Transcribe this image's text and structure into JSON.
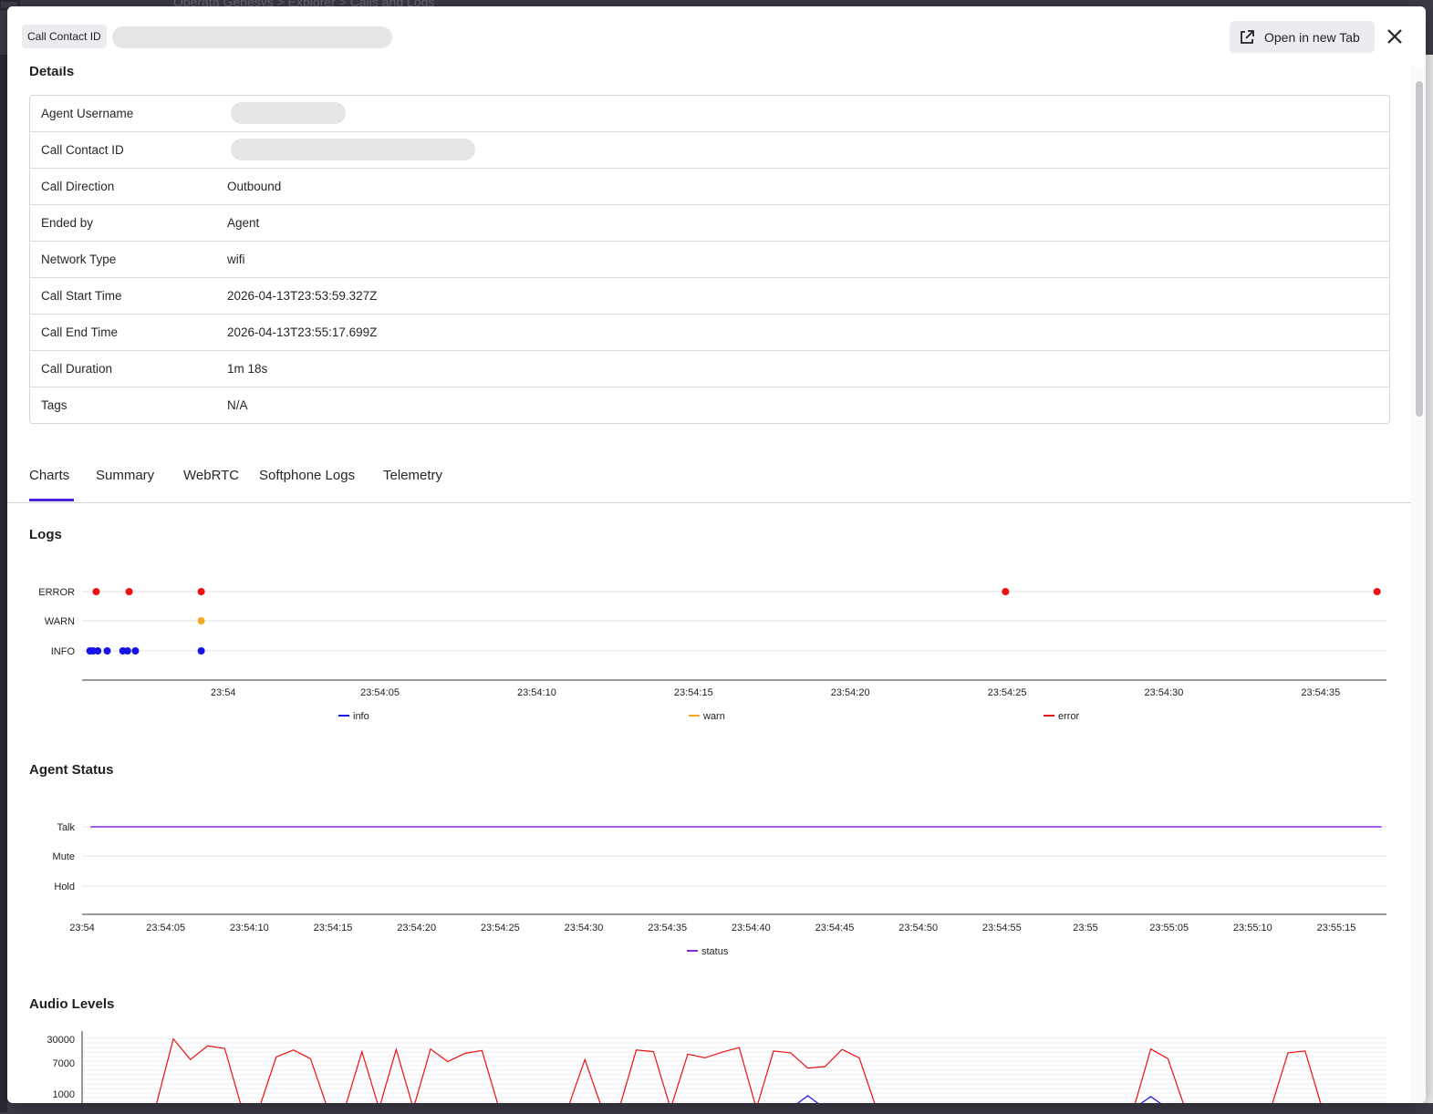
{
  "background": {
    "breadcrumbs": "Operata Genesys  >  Explorer  >  Calls and Logs"
  },
  "header": {
    "chip_label": "Call Contact ID",
    "open_tab_label": "Open in new Tab"
  },
  "details": {
    "title": "Details",
    "rows": [
      {
        "label": "Agent Username",
        "value": "",
        "redacted": true
      },
      {
        "label": "Call Contact ID",
        "value": "",
        "redacted": true
      },
      {
        "label": "Call Direction",
        "value": "Outbound"
      },
      {
        "label": "Ended by",
        "value": "Agent"
      },
      {
        "label": "Network Type",
        "value": "wifi"
      },
      {
        "label": "Call Start Time",
        "value": "2026-04-13T23:53:59.327Z"
      },
      {
        "label": "Call End Time",
        "value": "2026-04-13T23:55:17.699Z"
      },
      {
        "label": "Call Duration",
        "value": "1m 18s"
      },
      {
        "label": "Tags",
        "value": "N/A"
      }
    ]
  },
  "tabs": [
    "Charts",
    "Summary",
    "WebRTC",
    "Softphone Logs",
    "Telemetry"
  ],
  "active_tab": "Charts",
  "colors": {
    "accent": "#4a1fd6",
    "info": "#1414e6",
    "warn": "#f5a623",
    "error": "#ee1111",
    "status": "#8a2be2"
  },
  "chart_data": [
    {
      "type": "scatter",
      "title": "Logs",
      "y_categories": [
        "INFO",
        "WARN",
        "ERROR"
      ],
      "x_ticks": [
        "23:54",
        "23:54:05",
        "23:54:10",
        "23:54:15",
        "23:54:20",
        "23:54:25",
        "23:54:30",
        "23:54:35"
      ],
      "xlim": [
        "23:53:55.5",
        "23:54:37.1"
      ],
      "series": [
        {
          "name": "info",
          "color": "#1414e6",
          "points": [
            {
              "x": "23:53:55.75",
              "y": "INFO"
            },
            {
              "x": "23:53:55.85",
              "y": "INFO"
            },
            {
              "x": "23:53:56.0",
              "y": "INFO"
            },
            {
              "x": "23:53:56.3",
              "y": "INFO"
            },
            {
              "x": "23:53:56.8",
              "y": "INFO"
            },
            {
              "x": "23:53:56.95",
              "y": "INFO"
            },
            {
              "x": "23:53:57.2",
              "y": "INFO"
            },
            {
              "x": "23:53:59.3",
              "y": "INFO"
            }
          ]
        },
        {
          "name": "warn",
          "color": "#f5a623",
          "points": [
            {
              "x": "23:53:59.3",
              "y": "WARN"
            }
          ]
        },
        {
          "name": "error",
          "color": "#ee1111",
          "points": [
            {
              "x": "23:53:55.95",
              "y": "ERROR"
            },
            {
              "x": "23:53:57.0",
              "y": "ERROR"
            },
            {
              "x": "23:53:59.3",
              "y": "ERROR"
            },
            {
              "x": "23:54:24.95",
              "y": "ERROR"
            },
            {
              "x": "23:54:36.8",
              "y": "ERROR"
            }
          ]
        }
      ],
      "legend": [
        "info",
        "warn",
        "error"
      ],
      "legend_position": "bottom"
    },
    {
      "type": "line",
      "title": "Agent Status",
      "y_categories": [
        "Hold",
        "Mute",
        "Talk"
      ],
      "x_ticks": [
        "23:54",
        "23:54:05",
        "23:54:10",
        "23:54:15",
        "23:54:20",
        "23:54:25",
        "23:54:30",
        "23:54:35",
        "23:54:40",
        "23:54:45",
        "23:54:50",
        "23:54:55",
        "23:55",
        "23:55:05",
        "23:55:10",
        "23:55:15"
      ],
      "xlim": [
        "23:54:00",
        "23:55:18"
      ],
      "series": [
        {
          "name": "status",
          "color": "#8a2be2",
          "points": [
            {
              "x": "23:54:00.5",
              "y": "Talk"
            },
            {
              "x": "23:55:17.7",
              "y": "Talk"
            }
          ]
        }
      ],
      "legend": [
        "status"
      ],
      "legend_position": "bottom"
    },
    {
      "type": "line",
      "title": "Audio Levels",
      "y_scale": "log",
      "y_ticks": [
        1000,
        7000,
        30000
      ],
      "ylim": [
        600,
        32000
      ],
      "series": [
        {
          "name": "",
          "color": "#ee1111",
          "values": [
            500,
            500,
            500,
            500,
            500,
            31000,
            8500,
            20000,
            17000,
            400,
            400,
            10000,
            15500,
            9000,
            400,
            400,
            14000,
            400,
            16000,
            400,
            16500,
            7500,
            12500,
            15000,
            400,
            400,
            400,
            400,
            400,
            8500,
            400,
            400,
            15500,
            14000,
            400,
            12000,
            9500,
            13500,
            18000,
            400,
            14500,
            13000,
            5000,
            5500,
            16000,
            9500,
            400,
            400,
            400,
            400,
            400,
            400,
            400,
            400,
            400,
            400,
            400,
            400,
            400,
            400,
            400,
            400,
            16500,
            9000,
            400,
            400,
            400,
            400,
            400,
            400,
            13000,
            14500,
            400,
            400,
            400,
            400
          ]
        },
        {
          "name": "",
          "color": "#1414e6",
          "values": [
            400,
            400,
            400,
            400,
            400,
            400,
            400,
            400,
            400,
            400,
            400,
            400,
            400,
            400,
            400,
            400,
            400,
            400,
            400,
            400,
            400,
            400,
            400,
            400,
            400,
            400,
            400,
            400,
            400,
            400,
            400,
            400,
            400,
            400,
            400,
            400,
            400,
            400,
            400,
            400,
            400,
            400,
            900,
            400,
            400,
            400,
            400,
            400,
            400,
            400,
            400,
            400,
            400,
            400,
            400,
            400,
            400,
            400,
            400,
            400,
            400,
            400,
            850,
            400,
            400,
            400,
            400,
            400,
            400,
            400,
            400,
            400,
            400,
            400,
            400,
            400
          ]
        }
      ]
    }
  ]
}
